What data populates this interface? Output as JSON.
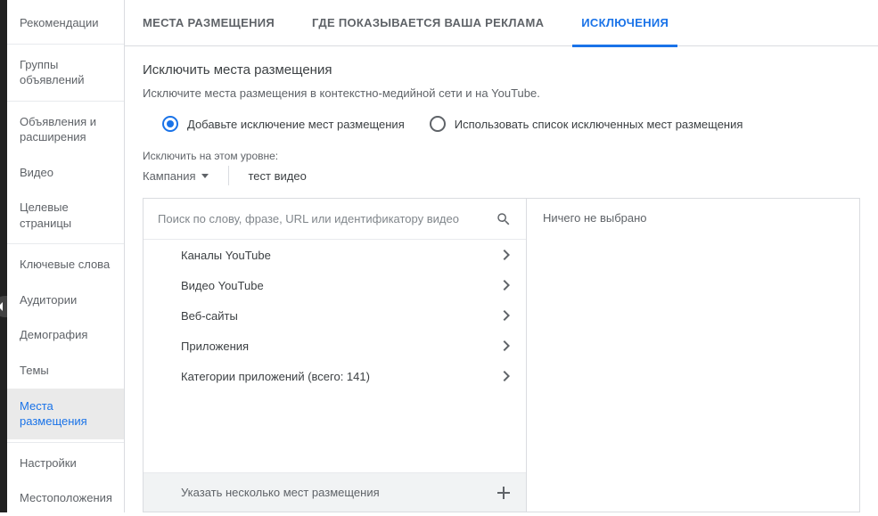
{
  "sidebar": {
    "items": [
      {
        "label": "Рекомендации"
      },
      {
        "label": "Группы объявлений"
      },
      {
        "label": "Объявления и расширения"
      },
      {
        "label": "Видео"
      },
      {
        "label": "Целевые страницы"
      },
      {
        "label": "Ключевые слова"
      },
      {
        "label": "Аудитории"
      },
      {
        "label": "Демография"
      },
      {
        "label": "Темы"
      },
      {
        "label": "Места размещения"
      },
      {
        "label": "Настройки"
      },
      {
        "label": "Местоположения"
      }
    ]
  },
  "tabs": [
    {
      "label": "МЕСТА РАЗМЕЩЕНИЯ"
    },
    {
      "label": "ГДЕ ПОКАЗЫВАЕТСЯ ВАША РЕКЛАМА"
    },
    {
      "label": "ИСКЛЮЧЕНИЯ"
    }
  ],
  "section": {
    "title": "Исключить места размещения",
    "description": "Исключите места размещения в контекстно-медийной сети и на YouTube."
  },
  "radio": {
    "add": "Добавьте исключение мест размещения",
    "use_list": "Использовать список исключенных мест размещения"
  },
  "level": {
    "label": "Исключить на этом уровне:",
    "dropdown": "Кампания",
    "value": "тест видео"
  },
  "search": {
    "placeholder": "Поиск по слову, фразе, URL или идентификатору видео"
  },
  "categories": [
    "Каналы YouTube",
    "Видео YouTube",
    "Веб-сайты",
    "Приложения",
    "Категории приложений (всего: 141)"
  ],
  "bulk_label": "Указать несколько мест размещения",
  "selection_empty": "Ничего не выбрано"
}
